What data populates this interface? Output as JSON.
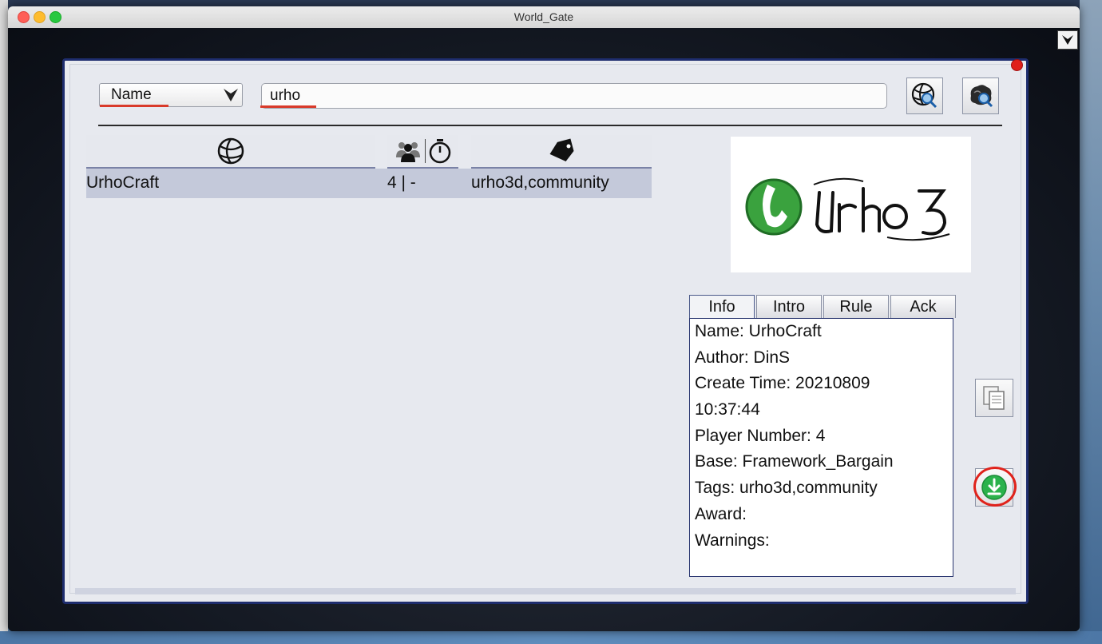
{
  "window": {
    "title": "World_Gate"
  },
  "search": {
    "field": "Name",
    "query": "urho"
  },
  "table": {
    "rows": [
      {
        "name": "UrhoCraft",
        "players": "4 | -",
        "tags": "urho3d,community"
      }
    ]
  },
  "tabs": [
    "Info",
    "Intro",
    "Rule",
    "Ack"
  ],
  "info": [
    "Name: UrhoCraft",
    "Author: DinS",
    "Create Time: 20210809",
    "10:37:44",
    "Player Number: 4",
    "Base: Framework_Bargain",
    "Tags: urho3d,community",
    "Award:",
    "Warnings:"
  ],
  "colors": {
    "accent_red": "#d93a2a",
    "border_blue": "#1e2d6e",
    "row_highlight": "#c4c9da",
    "download_green": "#2bb24c"
  },
  "icons": {
    "world": "world-icon",
    "players": "players-icon",
    "timer": "timer-icon",
    "tag": "tag-icon",
    "copy": "copy-icon",
    "download": "download-icon"
  }
}
